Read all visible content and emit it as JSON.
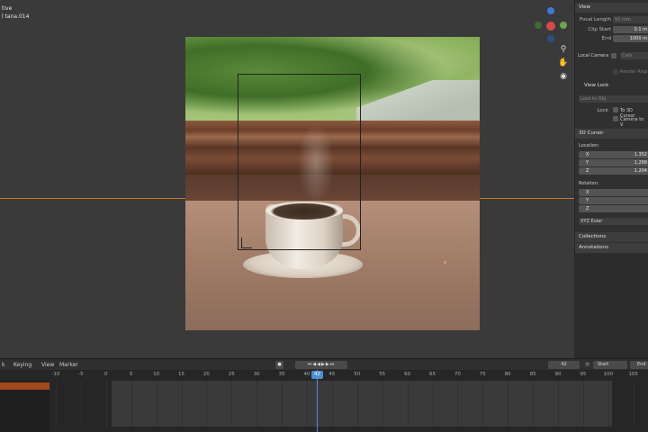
{
  "viewport": {
    "mode_text": "tive",
    "object_text": "l tana.014"
  },
  "sidebar": {
    "view_header": "View",
    "focal_length_label": "Focal Length",
    "focal_length_value": "50 mm",
    "clip_start_label": "Clip Start",
    "clip_start_value": "0.1 m",
    "end_label": "End",
    "end_value": "1000 m",
    "local_camera_label": "Local Camera",
    "local_camera_value": "Cam",
    "render_region_label": "Render Regi",
    "view_lock_header": "View Lock",
    "lock_to_obj_label": "Lock to Obj",
    "lock_label": "Lock",
    "to_3d_cursor_label": "To 3D Cursor",
    "camera_to_view_label": "Camera to V",
    "cursor_header": "3D Cursor",
    "location_label": "Location:",
    "loc_x_label": "X",
    "loc_x_value": "1.352",
    "loc_y_label": "Y",
    "loc_y_value": "1.299",
    "loc_z_label": "Z",
    "loc_z_value": "1.204",
    "rotation_label": "Rotation:",
    "rot_x_label": "X",
    "rot_y_label": "Y",
    "rot_z_label": "Z",
    "rotation_mode": "XYZ Euler",
    "collections_header": "Collections",
    "annotations_header": "Annotations"
  },
  "timeline": {
    "menu_left": "k",
    "keying_label": "Keying",
    "view_label": "View",
    "marker_label": "Marker",
    "current_frame": "42",
    "start_label": "Start",
    "end_label": "End",
    "ruler": [
      "-10",
      "-5",
      "0",
      "5",
      "10",
      "15",
      "20",
      "25",
      "30",
      "35",
      "40",
      "45",
      "50",
      "55",
      "60",
      "65",
      "70",
      "75",
      "80",
      "85",
      "90",
      "95",
      "100",
      "105"
    ]
  },
  "colors": {
    "accent_blue": "#4d8ed6",
    "horizon_orange": "#c97a28",
    "axis_x": "#d44a4a",
    "axis_y": "#6aa84f",
    "axis_z": "#3f7ad9"
  },
  "icons": [
    "zoom-icon",
    "hand-pan-icon",
    "camera-view-icon",
    "keyframe-icon",
    "jump-start-icon",
    "prev-key-icon",
    "play-reverse-icon",
    "play-icon",
    "next-key-icon",
    "jump-end-icon",
    "clock-icon"
  ]
}
